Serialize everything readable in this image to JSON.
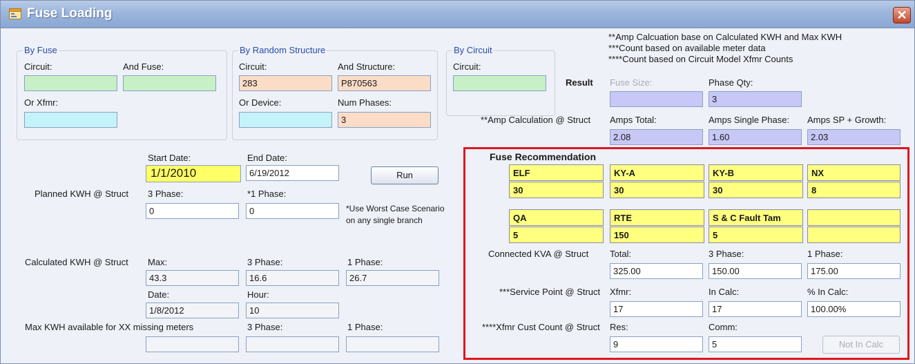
{
  "window": {
    "title": "Fuse Loading",
    "close_glyph": "✕",
    "accent": "#e0161e"
  },
  "by_fuse": {
    "title": "By Fuse",
    "circuit_label": "Circuit:",
    "circuit_value": "",
    "fuse_label": "And Fuse:",
    "fuse_value": "",
    "xfmr_label": "Or Xfmr:",
    "xfmr_value": ""
  },
  "by_random": {
    "title": "By Random Structure",
    "circuit_label": "Circuit:",
    "circuit_value": "283",
    "structure_label": "And Structure:",
    "structure_value": "P870563",
    "device_label": "Or Device:",
    "device_value": "",
    "phases_label": "Num Phases:",
    "phases_value": "3"
  },
  "by_circuit": {
    "title": "By Circuit",
    "circuit_label": "Circuit:",
    "circuit_value": ""
  },
  "notes": {
    "line1": "**Amp Calcuation base on Calculated KWH and Max KWH",
    "line2": "***Count based on available meter data",
    "line3": "****Count based on Circuit Model Xfmr Counts"
  },
  "result": {
    "label": "Result",
    "fuse_size_label": "Fuse Size:",
    "fuse_size_value": "",
    "phase_qty_label": "Phase Qty:",
    "phase_qty_value": "3"
  },
  "amp_calc": {
    "label": "**Amp Calculation @ Struct",
    "total_label": "Amps Total:",
    "total_value": "2.08",
    "single_label": "Amps Single Phase:",
    "single_value": "1.60",
    "growth_label": "Amps SP + Growth:",
    "growth_value": "2.03"
  },
  "dates": {
    "start_label": "Start Date:",
    "start_value": "1/1/2010",
    "end_label": "End Date:",
    "end_value": "6/19/2012",
    "run_label": "Run"
  },
  "planned": {
    "label": "Planned KWH @ Struct",
    "three_label": "3 Phase:",
    "three_value": "0",
    "one_label": "*1 Phase:",
    "one_value": "0",
    "note1": "*Use Worst Case Scenario",
    "note2": "on any single branch"
  },
  "calculated": {
    "label": "Calculated KWH @ Struct",
    "max_label": "Max:",
    "max_value": "43.3",
    "three_label": "3 Phase:",
    "three_value": "16.6",
    "one_label": "1 Phase:",
    "one_value": "26.7",
    "date_label": "Date:",
    "date_value": "1/8/2012",
    "hour_label": "Hour:",
    "hour_value": "10"
  },
  "max_kwh": {
    "label": "Max KWH available for XX missing meters",
    "three_label": "3 Phase:",
    "three_value": "",
    "one_label": "1 Phase:",
    "one_value": ""
  },
  "fuse_rec": {
    "title": "Fuse Recommendation",
    "row1": [
      {
        "name": "ELF",
        "value": "30"
      },
      {
        "name": "KY-A",
        "value": "30"
      },
      {
        "name": "KY-B",
        "value": "30"
      },
      {
        "name": "NX",
        "value": "8"
      }
    ],
    "row2": [
      {
        "name": "QA",
        "value": "5"
      },
      {
        "name": "RTE",
        "value": "150"
      },
      {
        "name": "S & C Fault Tam",
        "value": "5"
      },
      {
        "name": "",
        "value": ""
      }
    ]
  },
  "connected": {
    "label": "Connected KVA @ Struct",
    "total_label": "Total:",
    "total_value": "325.00",
    "three_label": "3 Phase:",
    "three_value": "150.00",
    "one_label": "1 Phase:",
    "one_value": "175.00"
  },
  "service": {
    "label": "***Service Point @ Struct",
    "xfmr_label": "Xfmr:",
    "xfmr_value": "17",
    "incalc_label": "In Calc:",
    "incalc_value": "17",
    "pct_label": "% In Calc:",
    "pct_value": "100.00%"
  },
  "xfmr_cust": {
    "label": "****Xfmr Cust Count @ Struct",
    "res_label": "Res:",
    "res_value": "9",
    "comm_label": "Comm:",
    "comm_value": "5",
    "notincalc_label": "Not In Calc"
  }
}
